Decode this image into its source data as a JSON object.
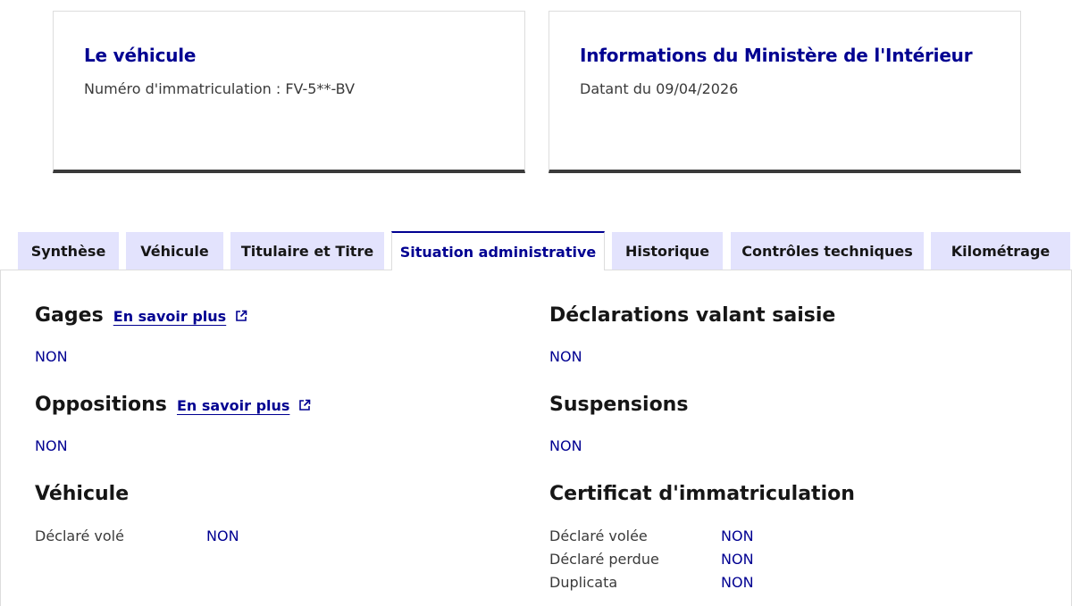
{
  "card_vehicle": {
    "title": "Le véhicule",
    "plate_text": "Numéro d'immatriculation : FV-5**-BV"
  },
  "card_ministry": {
    "title": "Informations du Ministère de l'Intérieur",
    "date_text": "Datant du 09/04/2026"
  },
  "tabs": [
    {
      "label": "Synthèse"
    },
    {
      "label": "Véhicule"
    },
    {
      "label": "Titulaire et Titre"
    },
    {
      "label": "Situation administrative",
      "active": true
    },
    {
      "label": "Historique"
    },
    {
      "label": "Contrôles techniques"
    },
    {
      "label": "Kilométrage"
    }
  ],
  "gages": {
    "title": "Gages",
    "link": "En savoir plus",
    "value": "NON"
  },
  "oppositions": {
    "title": "Oppositions",
    "link": "En savoir plus",
    "value": "NON"
  },
  "vehicule": {
    "title": "Véhicule",
    "rows": [
      {
        "label": "Déclaré volé",
        "value": "NON"
      }
    ]
  },
  "saisie": {
    "title": "Déclarations valant saisie",
    "value": "NON"
  },
  "suspensions": {
    "title": "Suspensions",
    "value": "NON"
  },
  "certificat": {
    "title": "Certificat d'immatriculation",
    "rows": [
      {
        "label": "Déclaré volée",
        "value": "NON"
      },
      {
        "label": "Déclaré perdue",
        "value": "NON"
      },
      {
        "label": "Duplicata",
        "value": "NON"
      }
    ]
  },
  "colors": {
    "primary": "#000091",
    "tab_bg": "#e3e3fd",
    "card_border": "#3a3a3a"
  }
}
